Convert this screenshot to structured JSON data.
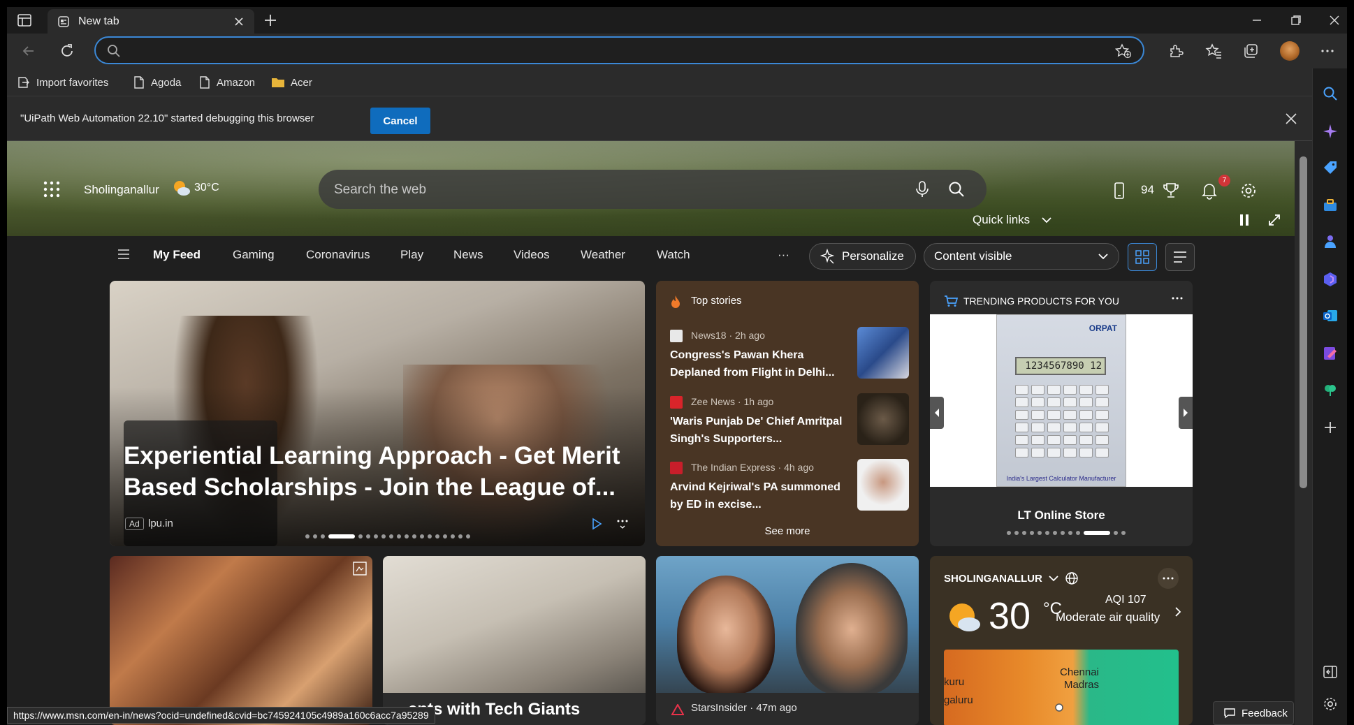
{
  "browser": {
    "tab": {
      "title": "New tab"
    },
    "address_bar": {
      "value": ""
    },
    "favorites": [
      "Import favorites",
      "Agoda",
      "Amazon",
      "Acer"
    ],
    "infobar": {
      "message": "\"UiPath Web Automation 22.10\" started debugging this browser",
      "cancel_label": "Cancel"
    },
    "status_url": "https://www.msn.com/en-in/news?ocid=undefined&cvid=bc745924105c4989a160c6acc7a95289"
  },
  "header": {
    "location": "Sholinganallur",
    "temperature": "30°C",
    "search_placeholder": "Search the web",
    "rewards_points": "94",
    "notification_count": "7",
    "quick_links_label": "Quick links"
  },
  "feed_nav": {
    "items": [
      "My Feed",
      "Gaming",
      "Coronavirus",
      "Play",
      "News",
      "Videos",
      "Weather",
      "Watch"
    ],
    "more": "···",
    "personalize_label": "Personalize",
    "content_visibility": "Content visible"
  },
  "main_article": {
    "headline": "Experiential Learning Approach - Get Merit Based Scholarships - Join the League of...",
    "ad_label": "Ad",
    "source": "lpu.in",
    "carousel_slides": 19,
    "carousel_active_index": 3
  },
  "top_stories": {
    "title": "Top stories",
    "items": [
      {
        "source": "News18",
        "age": "2h ago",
        "title": "Congress's Pawan Khera Deplaned from Flight in Delhi..."
      },
      {
        "source": "Zee News",
        "age": "1h ago",
        "title": "'Waris Punjab De' Chief Amritpal Singh's Supporters..."
      },
      {
        "source": "The Indian Express",
        "age": "4h ago",
        "title": "Arvind Kejriwal's PA summoned by ED in excise..."
      }
    ],
    "see_more": "See more"
  },
  "trending": {
    "title": "TRENDING PRODUCTS FOR YOU",
    "product_brand": "ORPAT",
    "product_display": "1234567890 12",
    "product_tagline": "India's Largest Calculator Manufacturer",
    "store": "LT Online Store",
    "carousel_slides": 13,
    "carousel_active_index": 10
  },
  "row2": {
    "tech_caption": "...ents with Tech Giants",
    "stars_source": "StarsInsider",
    "stars_age": "47m ago"
  },
  "weather_card": {
    "location": "SHOLINGANALLUR",
    "temp": "30",
    "unit": "°C",
    "aqi": "AQI 107",
    "air_quality": "Moderate air quality",
    "map_labels": [
      "Chennai",
      "Madras",
      "galuru",
      "kuru"
    ]
  },
  "feedback_label": "Feedback"
}
